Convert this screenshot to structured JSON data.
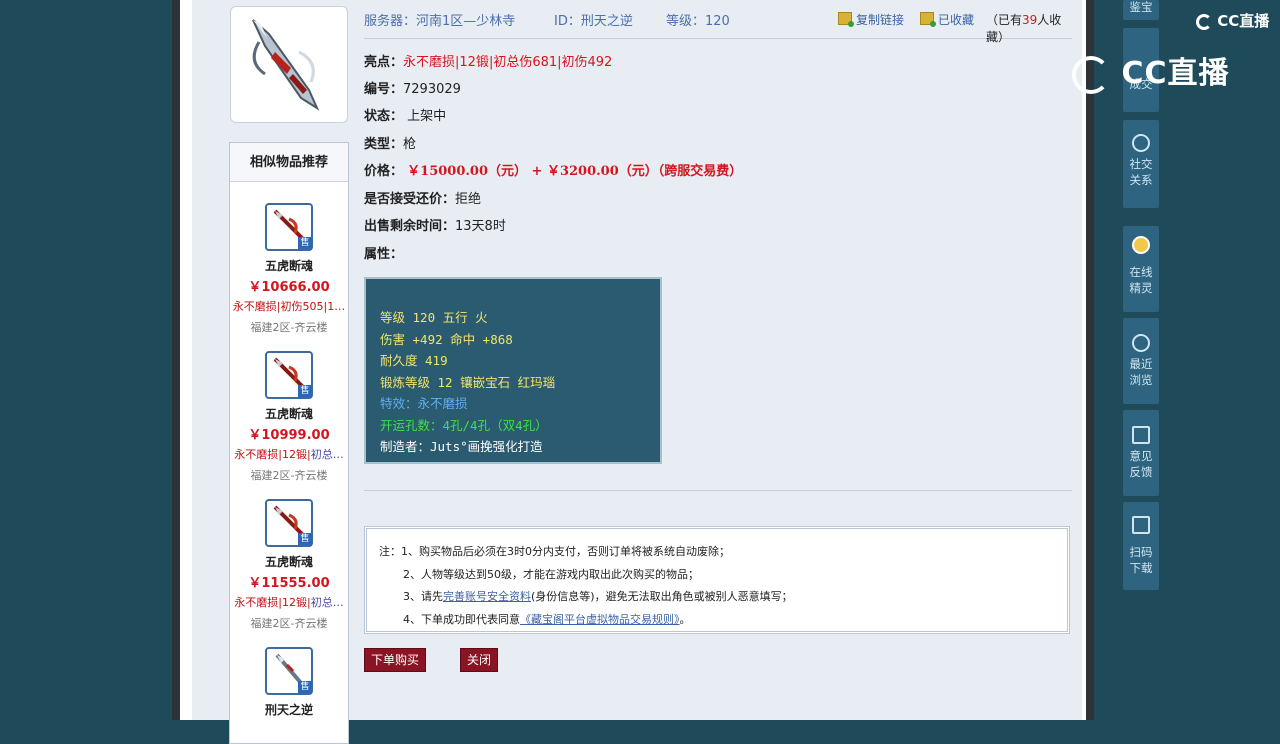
{
  "topbar": {
    "server": "服务器：河南1区—少林寺",
    "id": "ID：刑天之逆",
    "level": "等级：120",
    "copy_link": "复制链接",
    "favorited": "已收藏",
    "fav_count_prefix": "（已有",
    "fav_count": "39",
    "fav_count_suffix": "人收藏）"
  },
  "detail": {
    "highlights_label": "亮点：",
    "highlights_value": "永不磨损|12锻|初总伤681|初伤492",
    "serial_label": "编号：",
    "serial_value": "7293029",
    "status_label": "状态：",
    "status_value": "上架中",
    "type_label": "类型：",
    "type_value": "枪",
    "price_label": "价格：",
    "price_value": "￥15000.00（元） +  ￥3200.00（元）（跨服交易费）",
    "bargain_label": "是否接受还价：",
    "bargain_value": "拒绝",
    "time_label": "出售剩余时间：",
    "time_value": "13天8时",
    "attr_label": "属性："
  },
  "attributes": {
    "line1": "等级 120 五行 火",
    "line2": "伤害 +492 命中 +868",
    "line3": "耐久度 419",
    "line4": "锻炼等级 12 镶嵌宝石 红玛瑙",
    "line5": "特效：永不磨损",
    "line6": "开运孔数：4孔/4孔（双4孔）",
    "line7": "制造者：Juts°画挽强化打造"
  },
  "notes": {
    "line1": "注：1、购买物品后必须在3时0分内支付，否则订单将被系统自动废除；",
    "line2": "2、人物等级达到50级，才能在游戏内取出此次购买的物品；",
    "line3_pre": "3、请先",
    "line3_link": "完善账号安全资料",
    "line3_post": "(身份信息等)，避免无法取出角色或被别人恶意填写；",
    "line4_pre": "4、下单成功即代表同意",
    "line4_link": "《藏宝阁平台虚拟物品交易规则》",
    "line4_post": "。"
  },
  "buttons": {
    "order": "下单购买",
    "close": "关闭"
  },
  "recommend": {
    "title": "相似物品推荐",
    "sale_badge": "售",
    "items": [
      {
        "name": "五虎断魂",
        "price": "￥10666.00",
        "tags_red": "永不磨损|初伤505|1…",
        "tags_blue": "",
        "server": "福建2区-齐云楼"
      },
      {
        "name": "五虎断魂",
        "price": "￥10999.00",
        "tags_red": "永不磨损|12锻|",
        "tags_blue": "初总…",
        "server": "福建2区-齐云楼"
      },
      {
        "name": "五虎断魂",
        "price": "￥11555.00",
        "tags_red": "永不磨损|12锻|",
        "tags_blue": "初总…",
        "server": "福建2区-齐云楼"
      },
      {
        "name": "刑天之逆",
        "price": "",
        "tags_red": "",
        "tags_blue": "",
        "server": ""
      }
    ]
  },
  "rightbar": {
    "item0": "鉴宝",
    "item1": "成交",
    "item2": "社交关系",
    "item3": "在线精灵",
    "item4": "最近浏览",
    "item5": "意见反馈",
    "item6": "扫码下载"
  },
  "watermark": {
    "small": "CC直播",
    "big": "CC直播"
  }
}
